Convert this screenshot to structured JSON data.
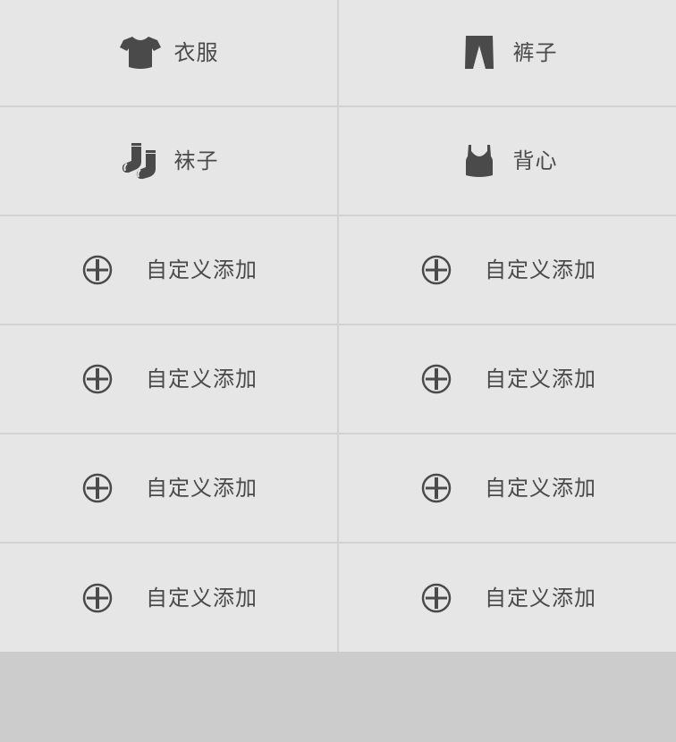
{
  "categories": [
    {
      "label": "衣服",
      "icon": "shirt-icon"
    },
    {
      "label": "裤子",
      "icon": "pants-icon"
    },
    {
      "label": "袜子",
      "icon": "socks-icon"
    },
    {
      "label": "背心",
      "icon": "vest-icon"
    }
  ],
  "custom_slots": [
    {
      "label": "自定义添加",
      "icon": "plus-circle-icon"
    },
    {
      "label": "自定义添加",
      "icon": "plus-circle-icon"
    },
    {
      "label": "自定义添加",
      "icon": "plus-circle-icon"
    },
    {
      "label": "自定义添加",
      "icon": "plus-circle-icon"
    },
    {
      "label": "自定义添加",
      "icon": "plus-circle-icon"
    },
    {
      "label": "自定义添加",
      "icon": "plus-circle-icon"
    },
    {
      "label": "自定义添加",
      "icon": "plus-circle-icon"
    },
    {
      "label": "自定义添加",
      "icon": "plus-circle-icon"
    }
  ],
  "colors": {
    "cell_background": "#e6e6e6",
    "grid_lines": "#d2d2d2",
    "icon_text": "#4a4a4a",
    "page_background": "#cccccc"
  }
}
